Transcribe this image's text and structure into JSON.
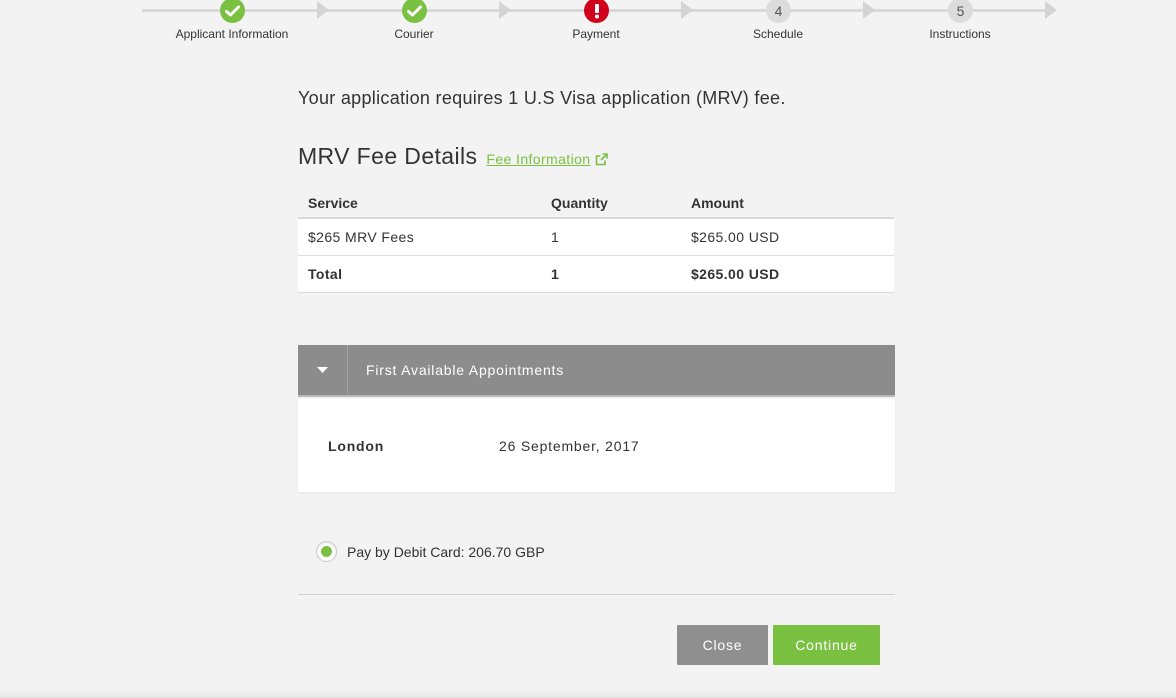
{
  "stepper": {
    "steps": [
      {
        "label": "Applicant Information",
        "state": "done",
        "icon": "check-icon"
      },
      {
        "label": "Courier",
        "state": "done",
        "icon": "check-icon"
      },
      {
        "label": "Payment",
        "state": "error",
        "icon": "exclamation-icon"
      },
      {
        "label": "Schedule",
        "state": "pending",
        "number": "4"
      },
      {
        "label": "Instructions",
        "state": "pending",
        "number": "5"
      }
    ]
  },
  "intro_text": "Your application requires 1 U.S Visa application (MRV) fee.",
  "fee_section": {
    "title": "MRV Fee Details",
    "link_label": "Fee Information",
    "link_icon": "external-link-icon"
  },
  "fee_table": {
    "headers": [
      "Service",
      "Quantity",
      "Amount"
    ],
    "rows": [
      [
        "$265 MRV Fees",
        "1",
        "$265.00 USD"
      ]
    ],
    "total": [
      "Total",
      "1",
      "$265.00 USD"
    ]
  },
  "appointments": {
    "title": "First Available Appointments",
    "toggle_icon": "caret-down-icon",
    "city": "London",
    "date": "26 September, 2017"
  },
  "payment_option": {
    "label": "Pay by Debit Card: 206.70 GBP",
    "selected": true
  },
  "buttons": {
    "close": "Close",
    "continue": "Continue"
  },
  "colors": {
    "accent": "#7ac142",
    "error": "#d0021b",
    "header_grey": "#8c8c8c",
    "close_grey": "#8f8f8f"
  }
}
